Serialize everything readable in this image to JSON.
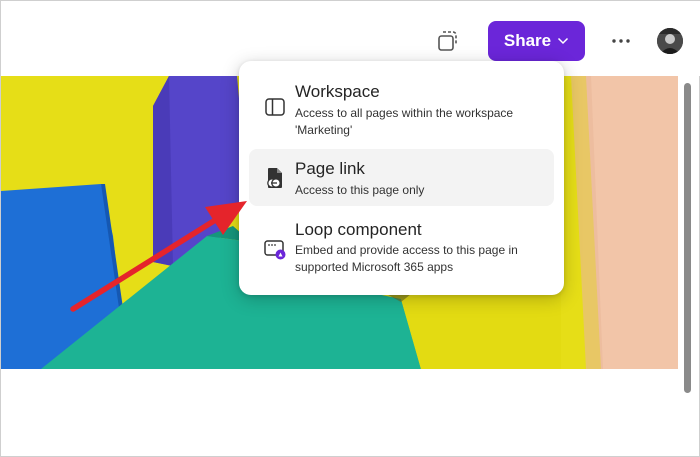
{
  "toolbar": {
    "share_label": "Share",
    "copy_icon": "copy-frame-icon",
    "more_icon": "more-horizontal-icon",
    "chevron_icon": "chevron-down-icon"
  },
  "share_menu": {
    "items": [
      {
        "title": "Workspace",
        "description": "Access to all pages within the workspace 'Marketing'",
        "icon": "panel-left-icon"
      },
      {
        "title": "Page link",
        "description": "Access to this page only",
        "icon": "page-link-icon"
      },
      {
        "title": "Loop component",
        "description": "Embed and provide access to this page in supported Microsoft 365 apps",
        "icon": "loop-component-icon"
      }
    ]
  },
  "colors": {
    "accent": "#6b26d9",
    "annotation_arrow": "#e5242b",
    "banner_yellow": "#e6de17",
    "banner_blue": "#1e6fd6",
    "banner_purple": "#5545c9",
    "banner_teal": "#1db394",
    "banner_peach": "#f2c5a8"
  }
}
